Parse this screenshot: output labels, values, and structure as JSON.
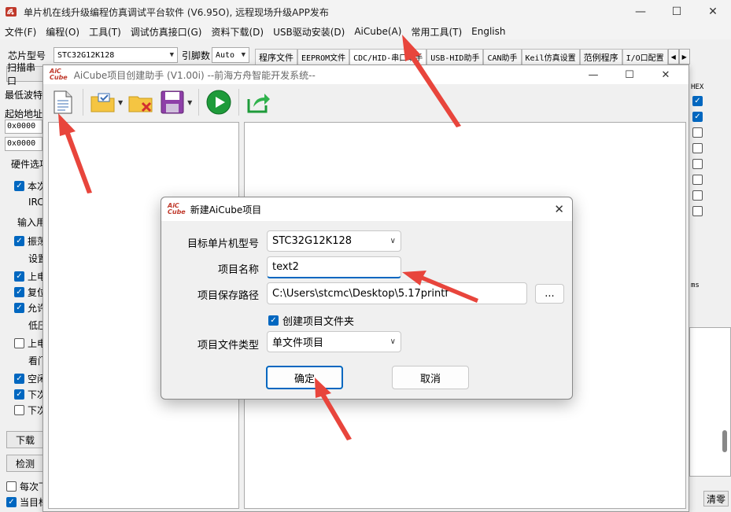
{
  "main_window": {
    "title": "单片机在线升级编程仿真调试平台软件 (V6.95O), 远程现场升级APP发布",
    "controls": {
      "minimize": "—",
      "maximize": "☐",
      "close": "✕"
    }
  },
  "menubar": {
    "items": [
      "文件(F)",
      "编程(O)",
      "工具(T)",
      "调试仿真接口(G)",
      "资料下载(D)",
      "USB驱动安装(D)",
      "AiCube(A)",
      "常用工具(T)",
      "English"
    ]
  },
  "left_panel": {
    "chip_label": "芯片型号",
    "chip_value": "STC32G12K128",
    "baud_label": "引脚数",
    "baud_value": "Auto",
    "scan_label": "扫描串口",
    "min_baud_label": "最低波特",
    "start_addr_label": "起始地址",
    "addr1": "0x0000",
    "addr2": "0x0000",
    "hw_options_label": "硬件选项",
    "options": [
      {
        "label": "本次",
        "checked": true
      },
      {
        "label": "IRC",
        "checked": null
      },
      {
        "label": "输入用",
        "checked": null
      },
      {
        "label": "振荡",
        "checked": true
      },
      {
        "label": "设置",
        "checked": null
      },
      {
        "label": "上电",
        "checked": true
      },
      {
        "label": "复位",
        "checked": true
      },
      {
        "label": "允许",
        "checked": true
      },
      {
        "label": "低压",
        "checked": null
      },
      {
        "label": "上电",
        "checked": false
      },
      {
        "label": "看门",
        "checked": null
      },
      {
        "label": "空闲",
        "checked": true
      },
      {
        "label": "下次",
        "checked": true
      },
      {
        "label": "下次",
        "checked": false
      }
    ],
    "download_btn": "下载",
    "check_btn": "检测",
    "each_label": "每次下",
    "current_label": "当目标"
  },
  "tabs": {
    "items": [
      "程序文件",
      "EEPROM文件",
      "CDC/HID-串口助手",
      "USB-HID助手",
      "CAN助手",
      "Keil仿真设置",
      "范例程序",
      "I/O口配置"
    ],
    "active_index": 2
  },
  "right_strip": {
    "hex_label": "HEX",
    "ms_label": "ms",
    "clear_btn": "清零",
    "checkboxes": [
      true,
      true,
      false,
      false,
      false,
      false,
      false,
      false
    ]
  },
  "helper_window": {
    "title": "AiCube项目创建助手 (V1.00i) --前海方舟智能开发系统--",
    "logo_top": "AiC",
    "logo_bottom": "Cube",
    "toolbar": [
      "new-project-icon",
      "open-project-icon",
      "close-project-icon",
      "save-project-icon",
      "run-icon",
      "export-icon"
    ]
  },
  "dialog": {
    "title": "新建AiCube项目",
    "target_label": "目标单片机型号",
    "target_value": "STC32G12K128",
    "name_label": "项目名称",
    "name_value": "text2",
    "path_label": "项目保存路径",
    "path_value": "C:\\Users\\stcmc\\Desktop\\5.17printf",
    "browse_label": "...",
    "create_folder_label": "创建项目文件夹",
    "create_folder_checked": true,
    "type_label": "项目文件类型",
    "type_value": "单文件项目",
    "ok_label": "确定",
    "cancel_label": "取消"
  },
  "colors": {
    "accent": "#0067c0",
    "arrow": "#e8453c"
  }
}
